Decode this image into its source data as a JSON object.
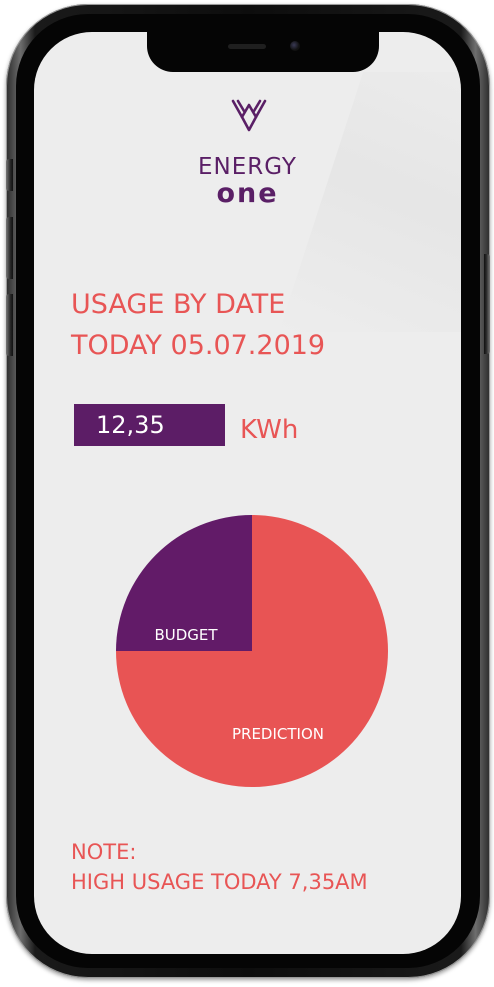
{
  "brand": {
    "name_top": "ENERGY",
    "name_bottom": "one",
    "logo_icon": "energy-one-logo-icon",
    "color": "#5a1f66"
  },
  "usage": {
    "heading": "USAGE BY DATE",
    "date_line": "TODAY 05.07.2019",
    "value": "12,35",
    "unit": "KWh"
  },
  "chart_data": {
    "type": "pie",
    "title": "",
    "slices": [
      {
        "label": "BUDGET",
        "value": 25,
        "color": "#621b68"
      },
      {
        "label": "PREDICTION",
        "value": 75,
        "color": "#e85454"
      }
    ]
  },
  "note": {
    "label": "NOTE:",
    "text": "HIGH USAGE TODAY 7,35AM"
  },
  "colors": {
    "accent": "#e85555",
    "primary": "#5c1d66",
    "screen_bg": "#ededed"
  }
}
